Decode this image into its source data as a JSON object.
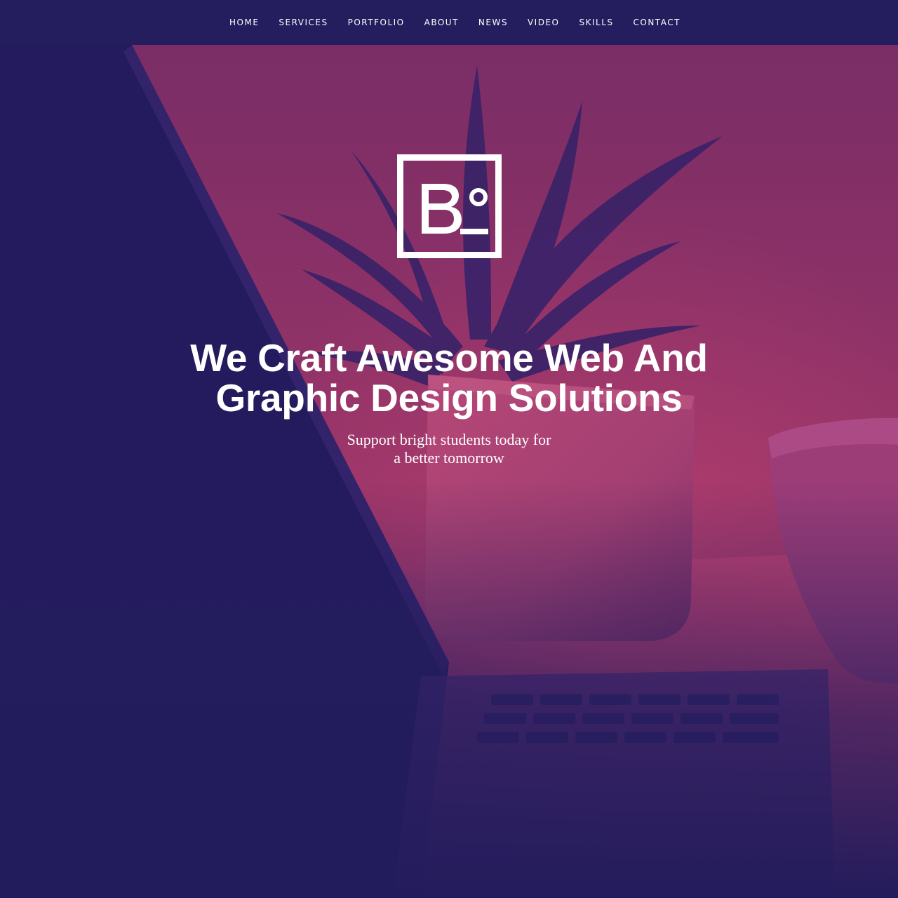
{
  "nav": {
    "items": [
      {
        "label": "HOME"
      },
      {
        "label": "SERVICES"
      },
      {
        "label": "PORTFOLIO"
      },
      {
        "label": "ABOUT"
      },
      {
        "label": "NEWS"
      },
      {
        "label": "VIDEO"
      },
      {
        "label": "SKILLS"
      },
      {
        "label": "CONTACT"
      }
    ]
  },
  "hero": {
    "logo_icon": "bo-logo-icon",
    "title_line1": "We Craft Awesome Web And",
    "title_line2": "Graphic Design Solutions",
    "subtitle_line1": "Support bright students today for",
    "subtitle_line2": "a better tomorrow"
  },
  "colors": {
    "navbar_bg": "#241d5e",
    "overlay_dark": "#231c5c",
    "overlay_magenta": "#b03a6e",
    "text": "#ffffff"
  }
}
